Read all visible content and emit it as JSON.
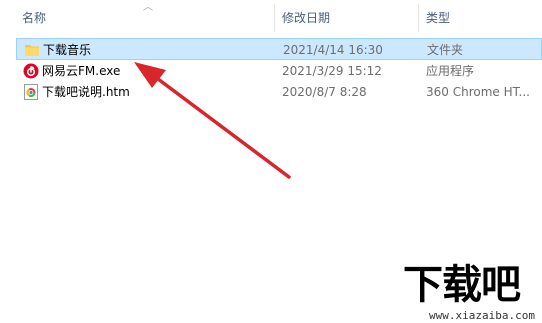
{
  "columns": {
    "name": "名称",
    "date": "修改日期",
    "type": "类型"
  },
  "files": [
    {
      "name": "下载音乐",
      "date": "2021/4/14 16:30",
      "type": "文件夹",
      "icon": "folder-icon",
      "selected": true
    },
    {
      "name": "网易云FM.exe",
      "date": "2021/3/29 15:12",
      "type": "应用程序",
      "icon": "netease-music-icon",
      "selected": false
    },
    {
      "name": "下载吧说明.htm",
      "date": "2020/8/7 8:28",
      "type": "360 Chrome HT...",
      "icon": "chrome-html-icon",
      "selected": false
    }
  ],
  "watermark": {
    "text": "下载吧",
    "url": "www.xiazaiba.com"
  },
  "colors": {
    "selection_bg": "#cce8ff",
    "selection_border": "#99d1ff",
    "header_text": "#4c607a",
    "arrow": "#d8262b"
  }
}
